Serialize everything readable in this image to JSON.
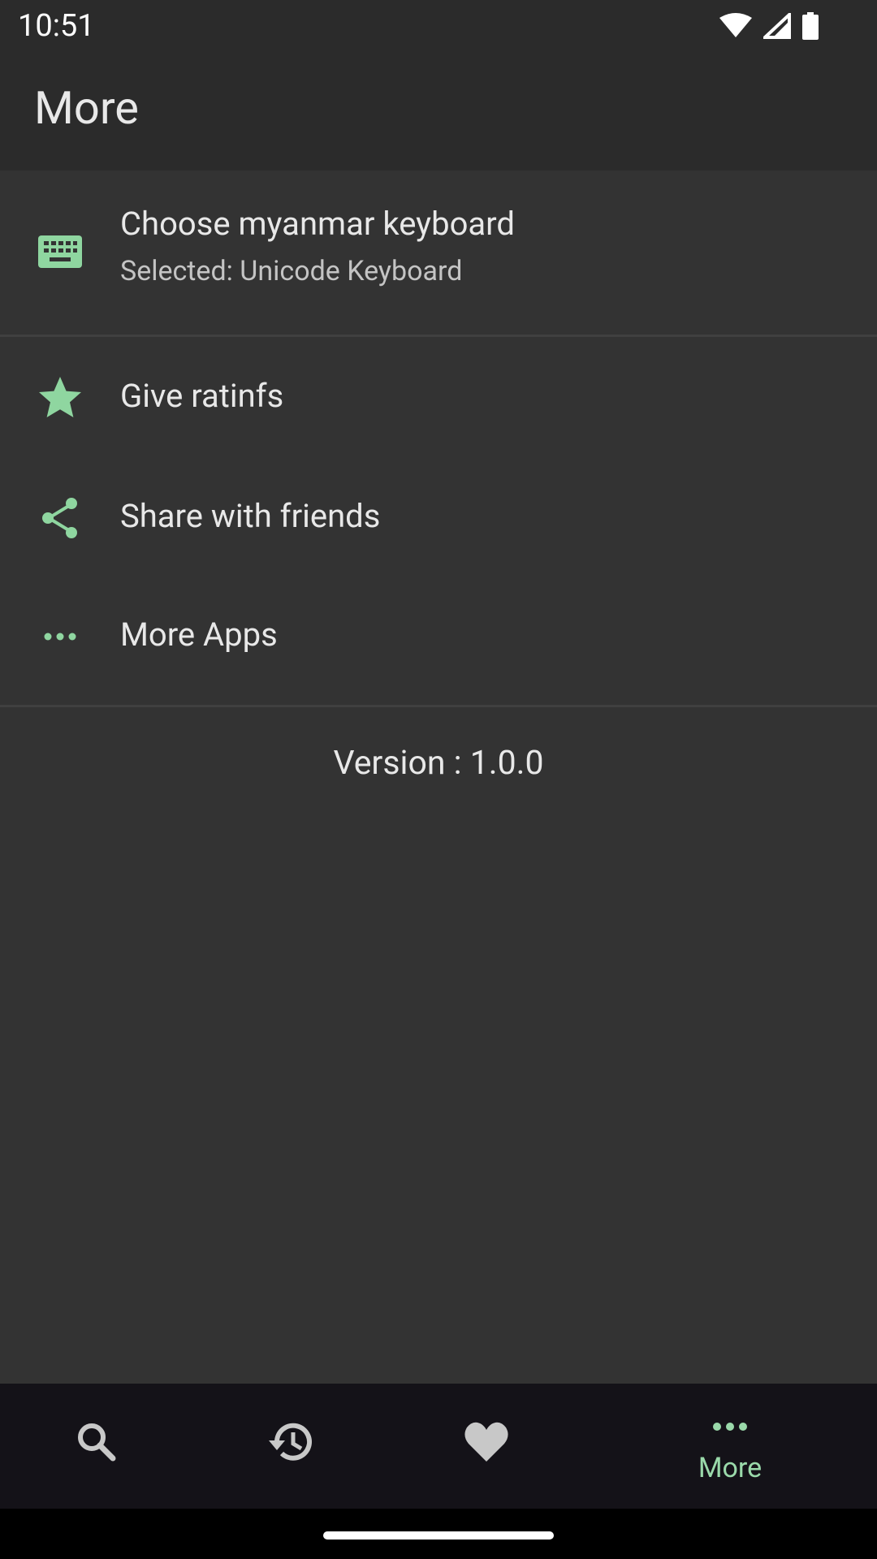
{
  "status_bar": {
    "time": "10:51",
    "icons": [
      "wifi-icon",
      "signal-icon",
      "battery-icon"
    ]
  },
  "app_bar": {
    "title": "More"
  },
  "settings": {
    "keyboard": {
      "icon": "keyboard-icon",
      "title": "Choose myanmar keyboard",
      "subtitle": "Selected: Unicode Keyboard"
    },
    "items": [
      {
        "icon": "star-icon",
        "label": "Give ratinfs"
      },
      {
        "icon": "share-icon",
        "label": "Share with friends"
      },
      {
        "icon": "more-horiz-icon",
        "label": "More Apps"
      }
    ],
    "version": "Version : 1.0.0"
  },
  "bottom_nav": {
    "items": [
      {
        "icon": "search-icon",
        "label": ""
      },
      {
        "icon": "history-icon",
        "label": ""
      },
      {
        "icon": "heart-icon",
        "label": ""
      },
      {
        "icon": "more-horiz-icon",
        "label": "More",
        "active": true
      }
    ]
  },
  "colors": {
    "accent": "#8fd6a0",
    "background": "#333333",
    "app_bar": "#2b2b2b",
    "bottom_nav": "#141218",
    "inactive_icon": "#c8c8c8"
  }
}
